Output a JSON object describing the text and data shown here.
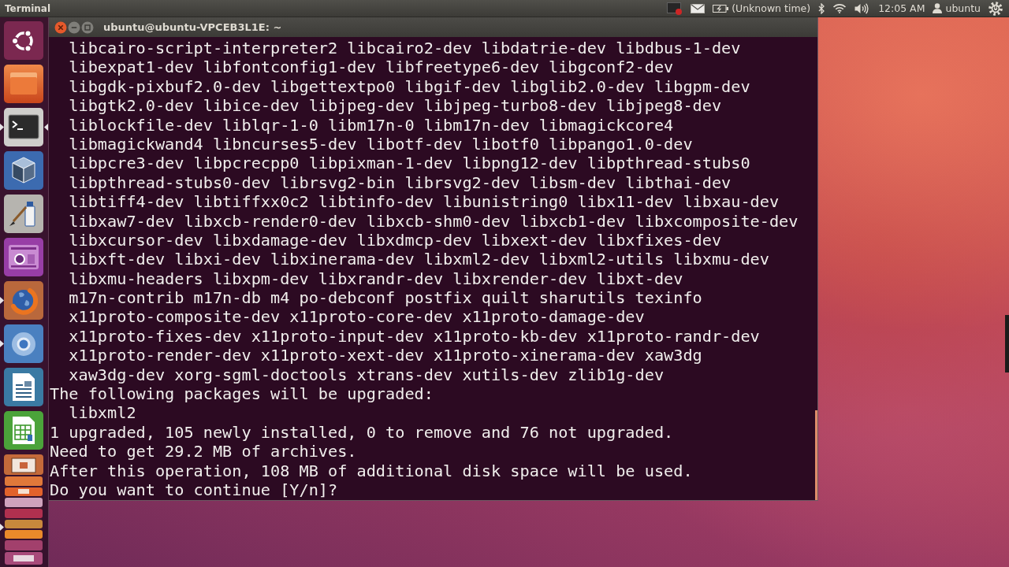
{
  "top_panel": {
    "app_title": "Terminal",
    "indicators": [
      {
        "kind": "record"
      },
      {
        "kind": "mail"
      },
      {
        "kind": "battery",
        "label": "(Unknown time)"
      },
      {
        "kind": "bluetooth"
      },
      {
        "kind": "wifi"
      },
      {
        "kind": "volume"
      },
      {
        "kind": "clock",
        "label": "12:05 AM"
      },
      {
        "kind": "user",
        "label": "ubuntu"
      },
      {
        "kind": "session"
      }
    ]
  },
  "launcher": {
    "items": [
      {
        "kind": "dash",
        "running": false,
        "focused": false
      },
      {
        "kind": "files",
        "running": false,
        "focused": false
      },
      {
        "kind": "terminal",
        "running": true,
        "focused": true
      },
      {
        "kind": "cube",
        "running": false,
        "focused": false
      },
      {
        "kind": "paint",
        "running": false,
        "focused": false
      },
      {
        "kind": "camera",
        "running": false,
        "focused": false
      },
      {
        "kind": "globe",
        "running": true,
        "focused": false
      },
      {
        "kind": "ring",
        "running": true,
        "focused": false
      },
      {
        "kind": "document",
        "running": false,
        "focused": false
      },
      {
        "kind": "spreadsheet",
        "running": false,
        "focused": false
      },
      {
        "kind": "stack",
        "running": true,
        "focused": false
      }
    ]
  },
  "terminal": {
    "title": "ubuntu@ubuntu-VPCEB3L1E: ~",
    "lines": [
      {
        "kind": "item",
        "text": "libcairo-script-interpreter2 libcairo2-dev libdatrie-dev libdbus-1-dev"
      },
      {
        "kind": "item",
        "text": "libexpat1-dev libfontconfig1-dev libfreetype6-dev libgconf2-dev"
      },
      {
        "kind": "item",
        "text": "libgdk-pixbuf2.0-dev libgettextpo0 libgif-dev libglib2.0-dev libgpm-dev"
      },
      {
        "kind": "item",
        "text": "libgtk2.0-dev libice-dev libjpeg-dev libjpeg-turbo8-dev libjpeg8-dev"
      },
      {
        "kind": "item",
        "text": "liblockfile-dev liblqr-1-0 libm17n-0 libm17n-dev libmagickcore4"
      },
      {
        "kind": "item",
        "text": "libmagickwand4 libncurses5-dev libotf-dev libotf0 libpango1.0-dev"
      },
      {
        "kind": "item",
        "text": "libpcre3-dev libpcrecpp0 libpixman-1-dev libpng12-dev libpthread-stubs0"
      },
      {
        "kind": "item",
        "text": "libpthread-stubs0-dev librsvg2-bin librsvg2-dev libsm-dev libthai-dev"
      },
      {
        "kind": "item",
        "text": "libtiff4-dev libtiffxx0c2 libtinfo-dev libunistring0 libx11-dev libxau-dev"
      },
      {
        "kind": "item",
        "text": "libxaw7-dev libxcb-render0-dev libxcb-shm0-dev libxcb1-dev libxcomposite-dev"
      },
      {
        "kind": "item",
        "text": "libxcursor-dev libxdamage-dev libxdmcp-dev libxext-dev libxfixes-dev"
      },
      {
        "kind": "item",
        "text": "libxft-dev libxi-dev libxinerama-dev libxml2-dev libxml2-utils libxmu-dev"
      },
      {
        "kind": "item",
        "text": "libxmu-headers libxpm-dev libxrandr-dev libxrender-dev libxt-dev"
      },
      {
        "kind": "item",
        "text": "m17n-contrib m17n-db m4 po-debconf postfix quilt sharutils texinfo"
      },
      {
        "kind": "item",
        "text": "x11proto-composite-dev x11proto-core-dev x11proto-damage-dev"
      },
      {
        "kind": "item",
        "text": "x11proto-fixes-dev x11proto-input-dev x11proto-kb-dev x11proto-randr-dev"
      },
      {
        "kind": "item",
        "text": "x11proto-render-dev x11proto-xext-dev x11proto-xinerama-dev xaw3dg"
      },
      {
        "kind": "item",
        "text": "xaw3dg-dev xorg-sgml-doctools xtrans-dev xutils-dev zlib1g-dev"
      },
      {
        "kind": "message",
        "text": "The following packages will be upgraded:"
      },
      {
        "kind": "item",
        "text": "libxml2"
      },
      {
        "kind": "message",
        "text": "1 upgraded, 105 newly installed, 0 to remove and 76 not upgraded."
      },
      {
        "kind": "message",
        "text": "Need to get 29.2 MB of archives."
      },
      {
        "kind": "message",
        "text": "After this operation, 108 MB of additional disk space will be used."
      },
      {
        "kind": "message",
        "text": "Do you want to continue [Y/n]?"
      }
    ]
  }
}
